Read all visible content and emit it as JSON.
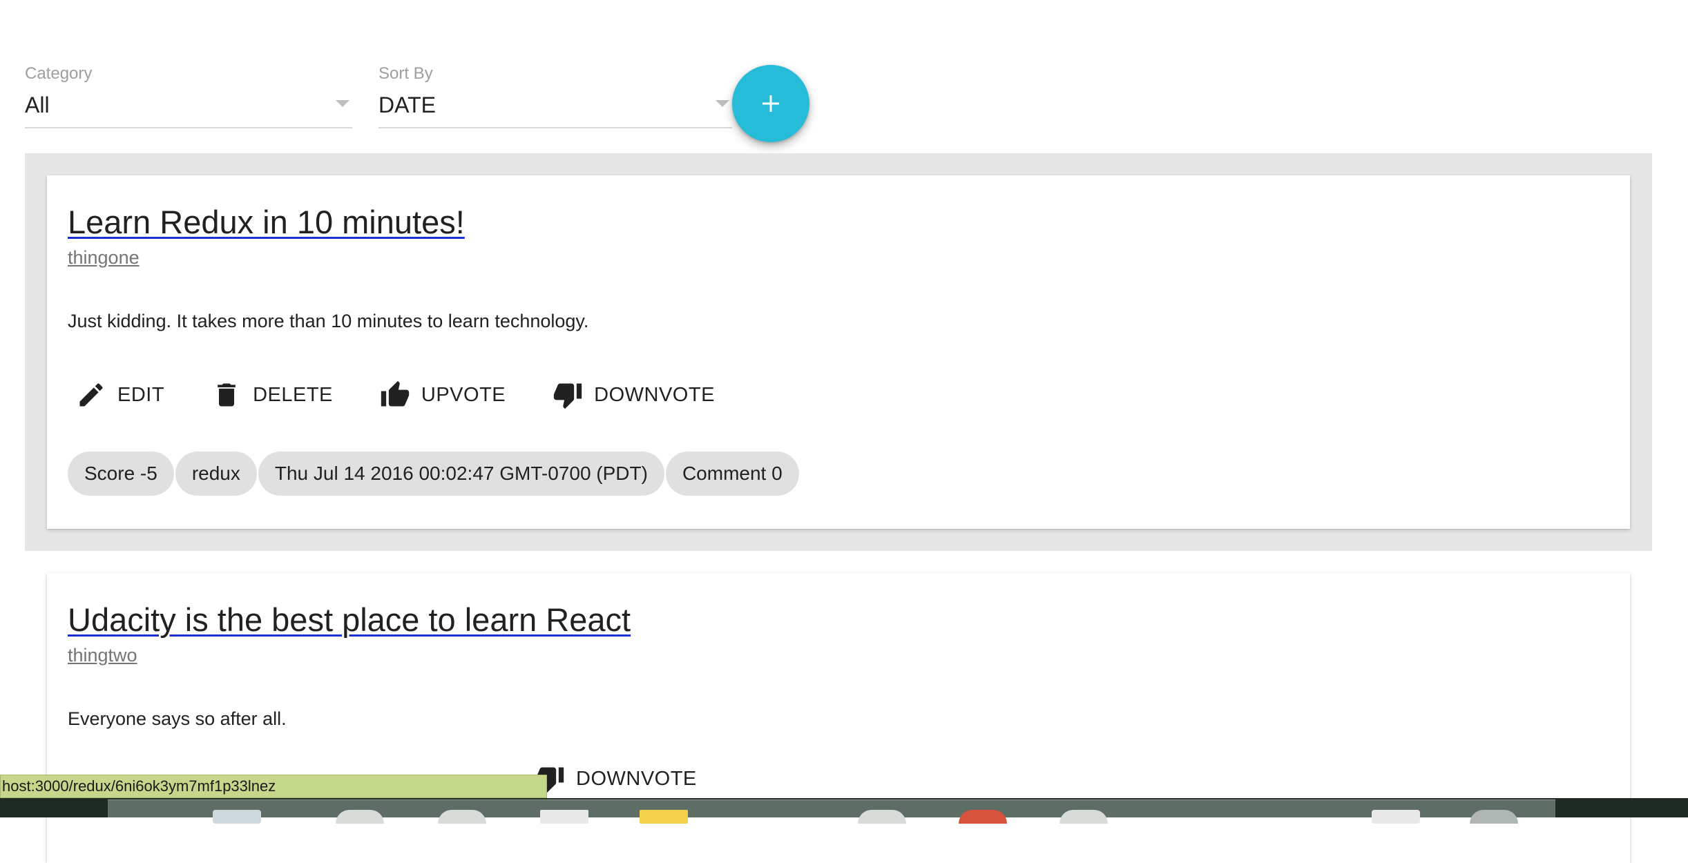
{
  "filters": {
    "category": {
      "label": "Category",
      "value": "All"
    },
    "sort": {
      "label": "Sort By",
      "value": "DATE"
    }
  },
  "fab": {
    "icon": "plus-icon"
  },
  "posts": [
    {
      "title": "Learn Redux in 10 minutes!",
      "author": "thingone",
      "body": "Just kidding. It takes more than 10 minutes to learn technology.",
      "actions": {
        "edit": "EDIT",
        "delete": "DELETE",
        "upvote": "UPVOTE",
        "downvote": "DOWNVOTE"
      },
      "chips": {
        "score": "Score -5",
        "category": "redux",
        "date": "Thu Jul 14 2016 00:02:47 GMT-0700 (PDT)",
        "comments": "Comment 0"
      }
    },
    {
      "title": "Udacity is the best place to learn React",
      "author": "thingtwo",
      "body": "Everyone says so after all.",
      "actions": {
        "downvote": "DOWNVOTE"
      }
    }
  ],
  "status_url": "host:3000/redux/6ni6ok3ym7mf1p33lnez",
  "colors": {
    "fab": "#26bcd7",
    "title_underline": "#1a2fd4",
    "statusbar": "#c4d78a"
  }
}
